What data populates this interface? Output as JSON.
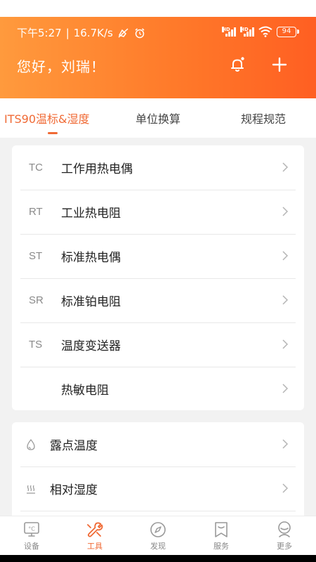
{
  "status_bar": {
    "time": "下午5:27",
    "speed": "16.7K/s",
    "hd_label": "HD",
    "battery": "94"
  },
  "header": {
    "greeting": "您好，刘瑞！"
  },
  "tabs": [
    {
      "label": "ITS90温标&湿度",
      "active": true
    },
    {
      "label": "单位换算",
      "active": false
    },
    {
      "label": "规程规范",
      "active": false
    }
  ],
  "temperature_list": [
    {
      "code": "TC",
      "label": "工作用热电偶"
    },
    {
      "code": "RT",
      "label": "工业热电阻"
    },
    {
      "code": "ST",
      "label": "标准热电偶"
    },
    {
      "code": "SR",
      "label": "标准铂电阻"
    },
    {
      "code": "TS",
      "label": "温度变送器"
    },
    {
      "code": "",
      "label": "热敏电阻"
    }
  ],
  "humidity_list": [
    {
      "icon": "droplet-icon",
      "label": "露点温度"
    },
    {
      "icon": "heat-waves-icon",
      "label": "相对湿度"
    }
  ],
  "bottom_nav": [
    {
      "label": "设备",
      "icon": "thermometer-monitor-icon",
      "active": false
    },
    {
      "label": "工具",
      "icon": "wrench-icon",
      "active": true
    },
    {
      "label": "发现",
      "icon": "compass-icon",
      "active": false
    },
    {
      "label": "服务",
      "icon": "bookmark-icon",
      "active": false
    },
    {
      "label": "更多",
      "icon": "robot-icon",
      "active": false
    }
  ],
  "colors": {
    "accent": "#f06a35",
    "header_start": "#ff9a3d",
    "header_end": "#ff5f22"
  }
}
